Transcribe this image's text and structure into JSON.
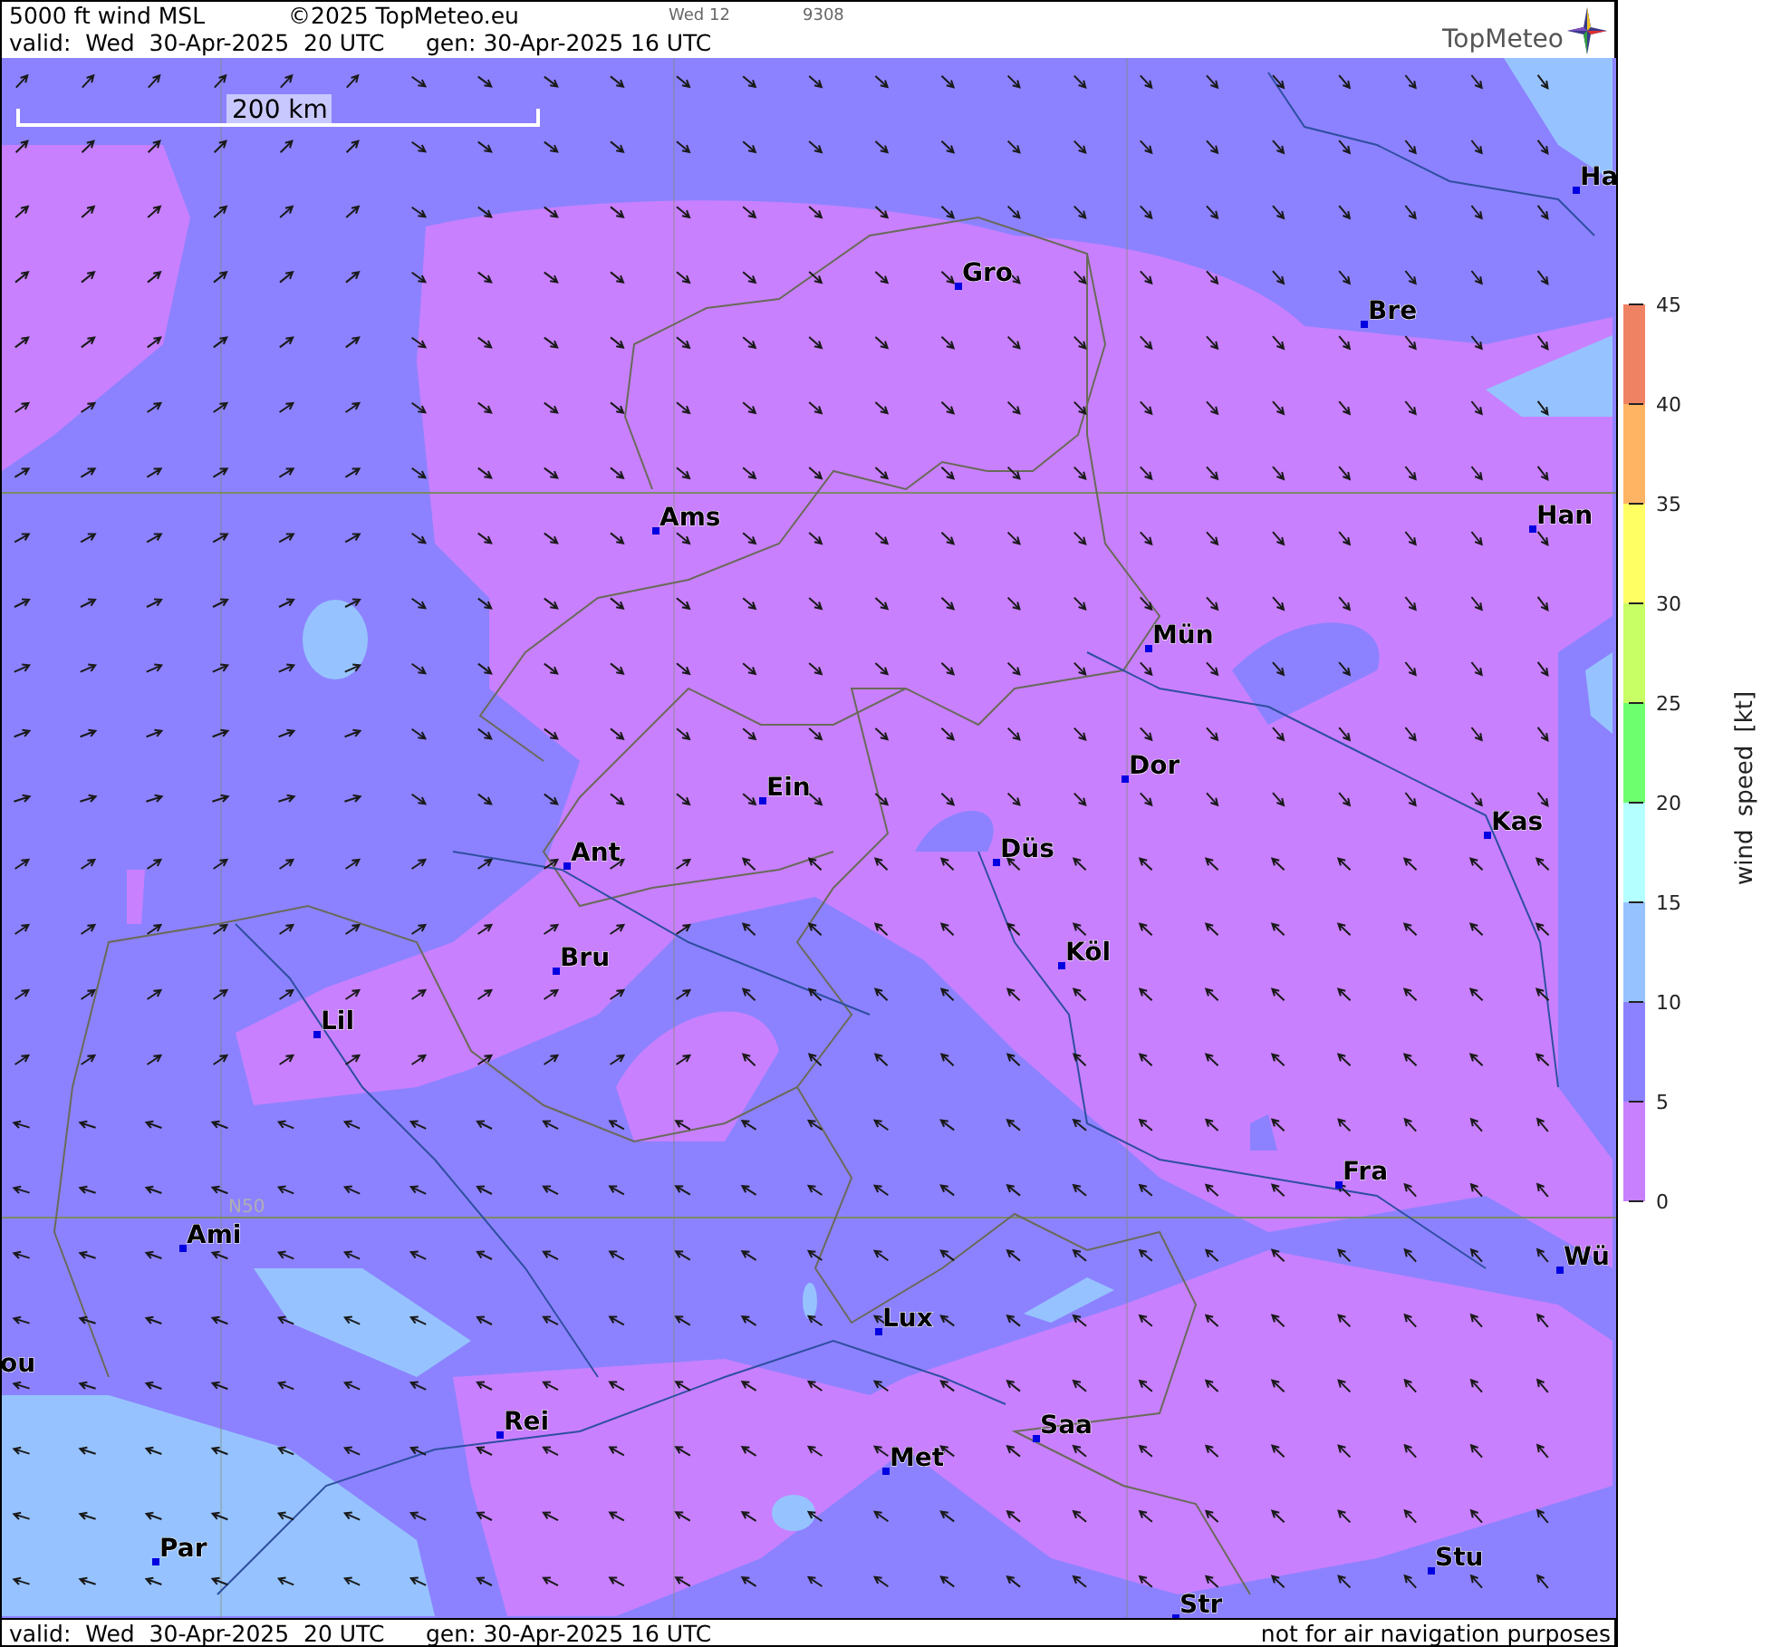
{
  "header": {
    "title": "5000 ft wind MSL",
    "copyright": "©2025 TopMeteo.eu",
    "run_label": "Wed 12",
    "code": "9308",
    "valid": "valid:  Wed  30-Apr-2025  20 UTC",
    "generated": "gen: 30-Apr-2025 16 UTC",
    "logo": "TopMeteo"
  },
  "map": {
    "scale_label": "200 km",
    "latitude_label": "N50",
    "cities": [
      {
        "name": "Ha"
      },
      {
        "name": "Gro"
      },
      {
        "name": "Bre"
      },
      {
        "name": "Ams"
      },
      {
        "name": "Han"
      },
      {
        "name": "Mün"
      },
      {
        "name": "Dor"
      },
      {
        "name": "Ein"
      },
      {
        "name": "Kas"
      },
      {
        "name": "Ant"
      },
      {
        "name": "Düs"
      },
      {
        "name": "Bru"
      },
      {
        "name": "Köl"
      },
      {
        "name": "Lil"
      },
      {
        "name": "Fra"
      },
      {
        "name": "Ami"
      },
      {
        "name": "Wü"
      },
      {
        "name": "Lux"
      },
      {
        "name": "ou"
      },
      {
        "name": "Rei"
      },
      {
        "name": "Saa"
      },
      {
        "name": "Met"
      },
      {
        "name": "Par"
      },
      {
        "name": "Stu"
      },
      {
        "name": "Str"
      }
    ]
  },
  "legend": {
    "title": "wind speed [kt]",
    "bands": [
      {
        "color": "#c880ff"
      },
      {
        "color": "#8c82ff"
      },
      {
        "color": "#96c3ff"
      },
      {
        "color": "#b4ffff"
      },
      {
        "color": "#6eff6e"
      },
      {
        "color": "#c8ff64"
      },
      {
        "color": "#ffff64"
      },
      {
        "color": "#ffb464"
      },
      {
        "color": "#f08264"
      }
    ],
    "ticks": [
      "45",
      "40",
      "35",
      "30",
      "25",
      "20",
      "15",
      "10",
      "5",
      "0"
    ]
  },
  "footer": {
    "valid": "valid:  Wed  30-Apr-2025  20 UTC",
    "generated": "gen: 30-Apr-2025 16 UTC",
    "disclaimer": "not for air navigation purposes"
  }
}
